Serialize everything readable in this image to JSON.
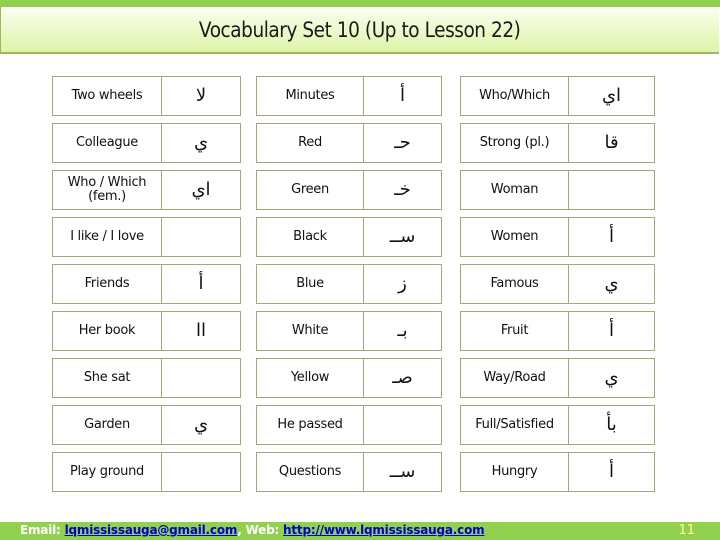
{
  "slide": {
    "title": "Vocabulary Set 10 (Up to Lesson 22)",
    "page_number": "11",
    "colors": {
      "accent_green": "#92d050",
      "header_gradient_light": "#fbfff0",
      "header_gradient_dark": "#dcf5a9",
      "cell_border": "#a3a77a",
      "link_blue": "#0000cc",
      "page_number": "#ffff99"
    }
  },
  "vocabulary": {
    "columns": [
      {
        "rows": [
          {
            "english": "Two wheels",
            "arabic": "لا"
          },
          {
            "english": "Colleague",
            "arabic": "ي"
          },
          {
            "english": "Who / Which (fem.)",
            "arabic": "اي"
          },
          {
            "english": "I like / I love",
            "arabic": ""
          },
          {
            "english": "Friends",
            "arabic": "أ"
          },
          {
            "english": "Her book",
            "arabic": "اا"
          },
          {
            "english": "She sat",
            "arabic": ""
          },
          {
            "english": "Garden",
            "arabic": "ي"
          },
          {
            "english": "Play ground",
            "arabic": ""
          }
        ]
      },
      {
        "rows": [
          {
            "english": "Minutes",
            "arabic": "أ"
          },
          {
            "english": "Red",
            "arabic": "حـ"
          },
          {
            "english": "Green",
            "arabic": "خـ"
          },
          {
            "english": "Black",
            "arabic": "ســ"
          },
          {
            "english": "Blue",
            "arabic": "ز"
          },
          {
            "english": "White",
            "arabic": "بـ"
          },
          {
            "english": "Yellow",
            "arabic": "صـ"
          },
          {
            "english": "He passed",
            "arabic": ""
          },
          {
            "english": "Questions",
            "arabic": "ســ"
          }
        ]
      },
      {
        "rows": [
          {
            "english": "Who/Which",
            "arabic": "اي"
          },
          {
            "english": "Strong (pl.)",
            "arabic": "قا"
          },
          {
            "english": "Woman",
            "arabic": ""
          },
          {
            "english": "Women",
            "arabic": "أ"
          },
          {
            "english": "Famous",
            "arabic": "ي"
          },
          {
            "english": "Fruit",
            "arabic": "أ"
          },
          {
            "english": "Way/Road",
            "arabic": "ي"
          },
          {
            "english": "Full/Satisfied",
            "arabic": "بأ"
          },
          {
            "english": "Hungry",
            "arabic": "أ"
          }
        ]
      }
    ]
  },
  "footer": {
    "email_label": "Email: ",
    "email": "lqmississauga@gmail.com",
    "separator": ", ",
    "web_label": "Web: ",
    "web_url": "http://www.lqmississauga.com"
  }
}
